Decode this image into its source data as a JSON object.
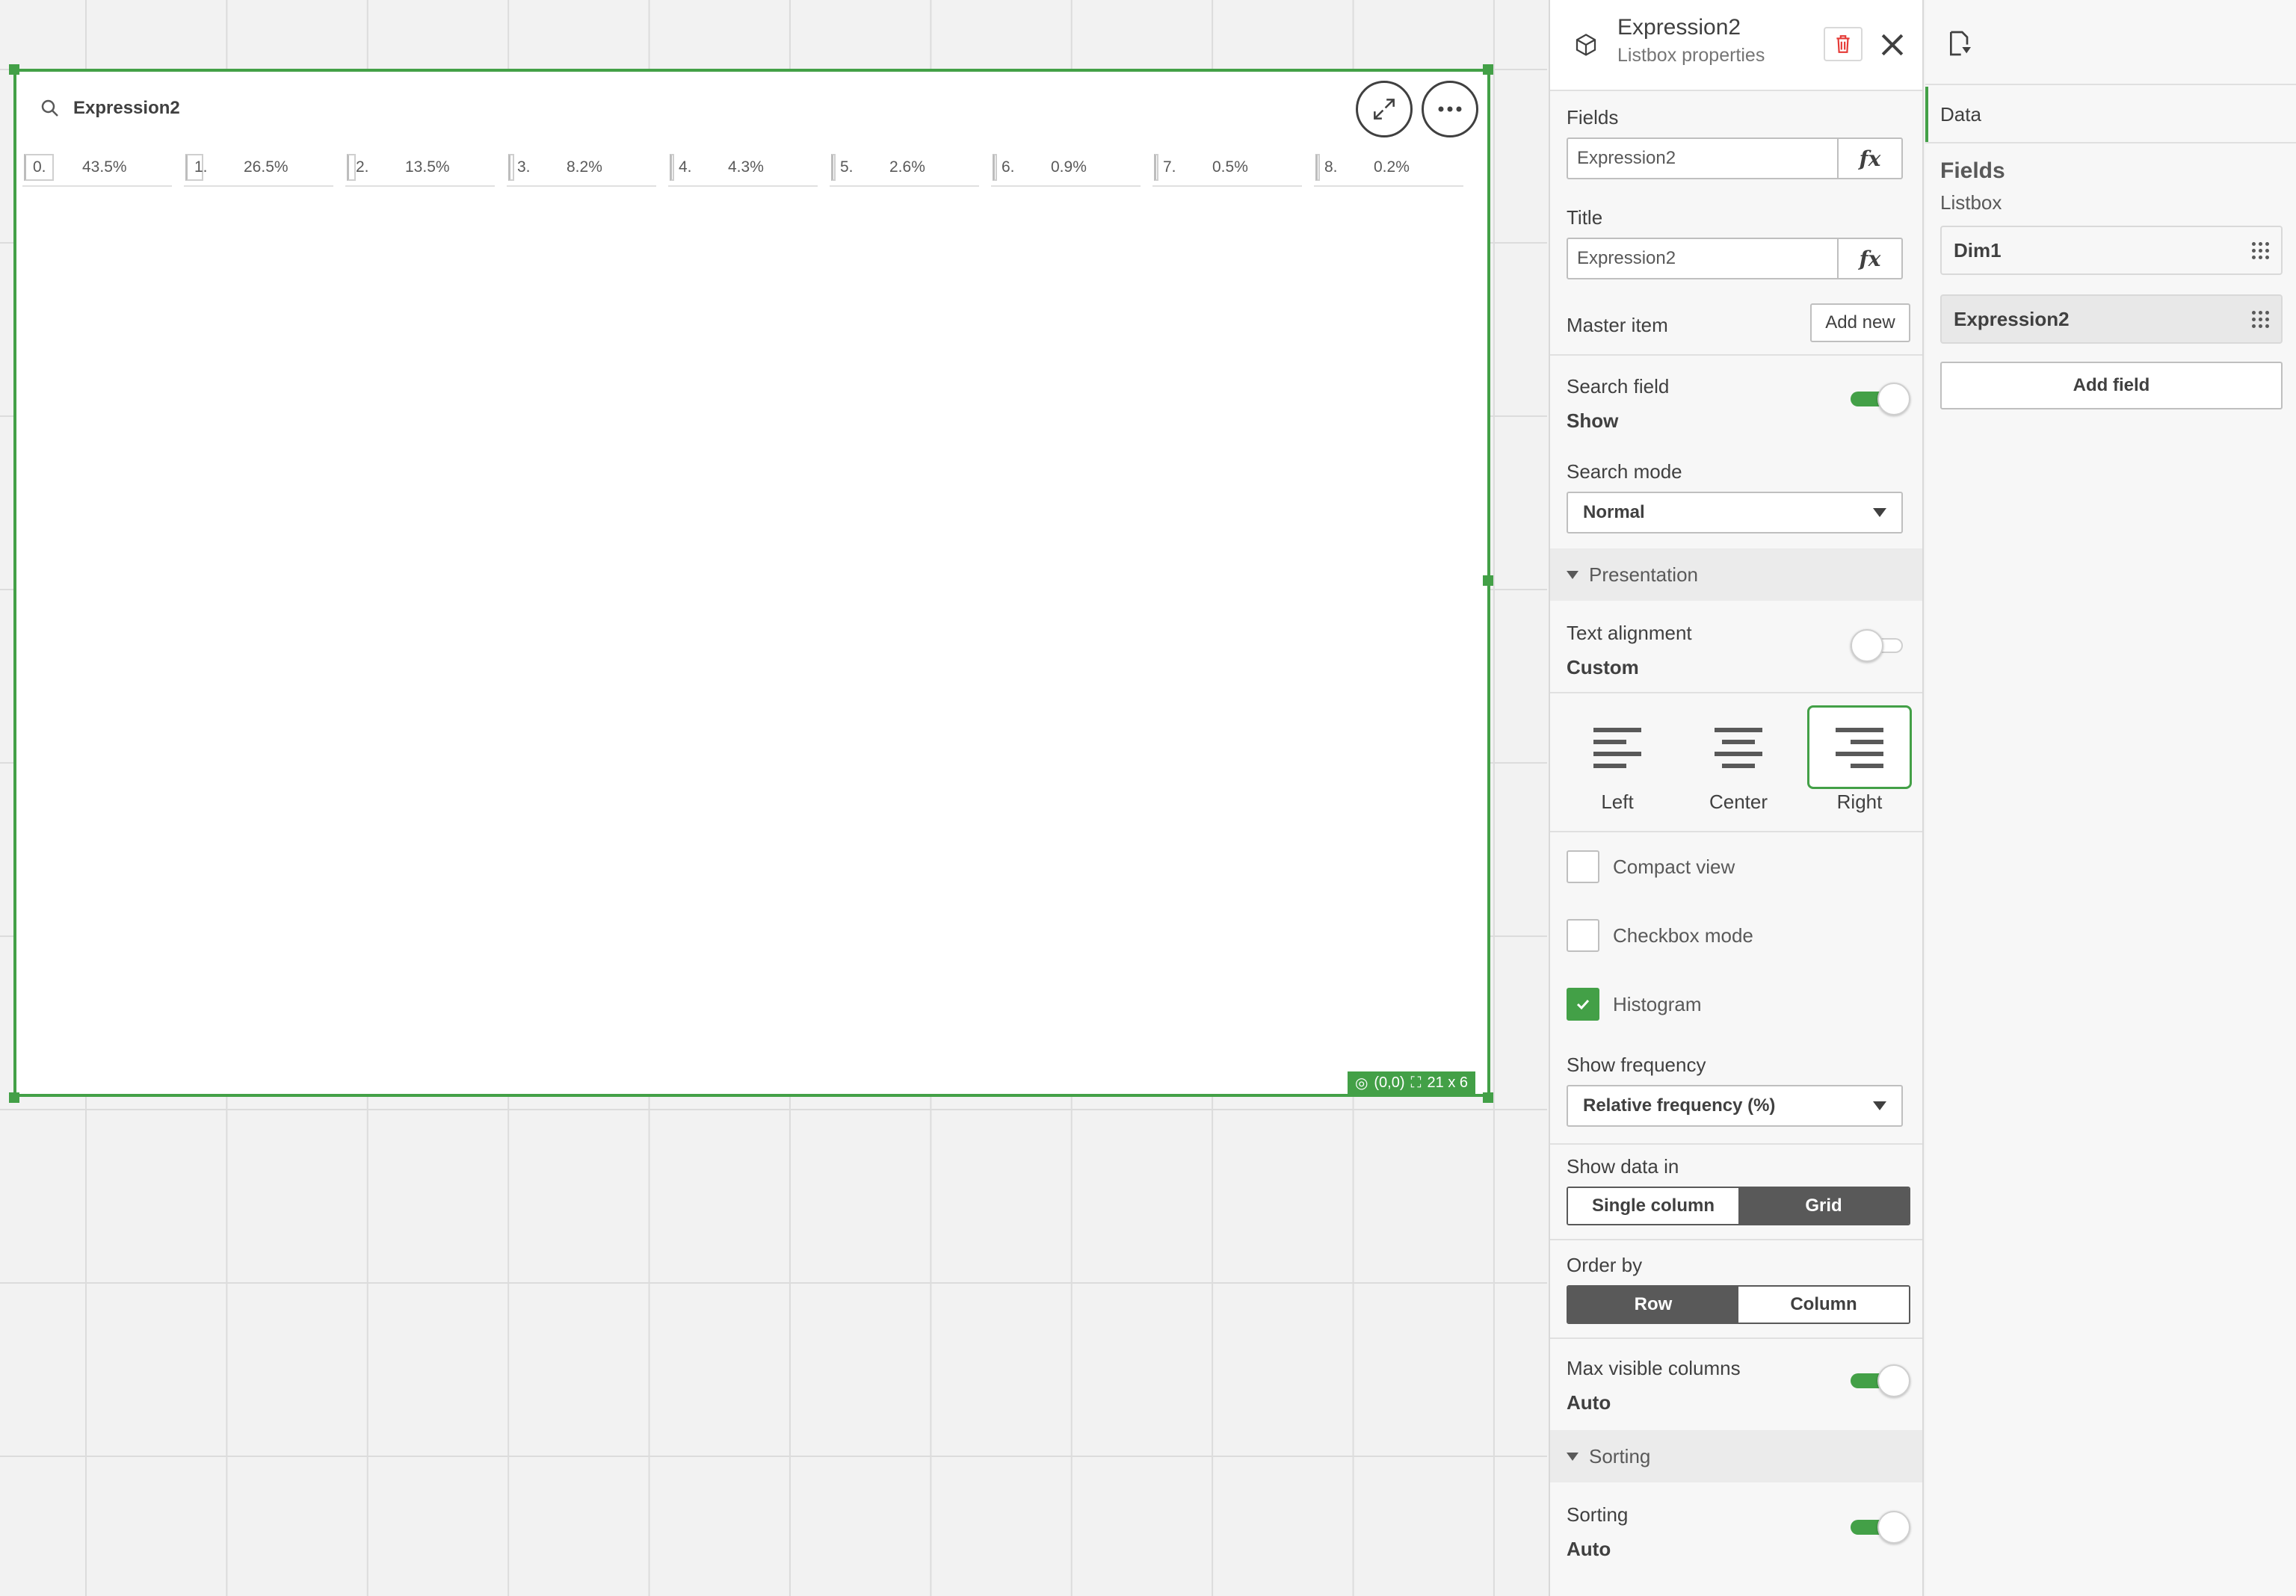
{
  "listbox": {
    "title": "Expression2",
    "cells": [
      {
        "name": "0.",
        "freq": "43.5%",
        "pct": 43.5
      },
      {
        "name": "1.",
        "freq": "26.5%",
        "pct": 26.5
      },
      {
        "name": "2.",
        "freq": "13.5%",
        "pct": 13.5
      },
      {
        "name": "3.",
        "freq": "8.2%",
        "pct": 8.2
      },
      {
        "name": "4.",
        "freq": "4.3%",
        "pct": 4.3
      },
      {
        "name": "5.",
        "freq": "2.6%",
        "pct": 2.6
      },
      {
        "name": "6.",
        "freq": "0.9%",
        "pct": 0.9
      },
      {
        "name": "7.",
        "freq": "0.5%",
        "pct": 0.5
      },
      {
        "name": "8.",
        "freq": "0.2%",
        "pct": 0.2
      }
    ],
    "position": "(0,0)",
    "size": "21 x 6"
  },
  "properties": {
    "title": "Expression2",
    "subtitle": "Listbox properties",
    "fields_label": "Fields",
    "fields_value": "Expression2",
    "title_label": "Title",
    "title_value": "Expression2",
    "fx": "fx",
    "master_item_label": "Master item",
    "add_new": "Add new",
    "search_field_label": "Search field",
    "search_field_value": "Show",
    "search_mode_label": "Search mode",
    "search_mode_value": "Normal",
    "presentation": "Presentation",
    "text_alignment_label": "Text alignment",
    "text_alignment_value": "Custom",
    "align_left": "Left",
    "align_center": "Center",
    "align_right": "Right",
    "compact_view": "Compact view",
    "checkbox_mode": "Checkbox mode",
    "histogram": "Histogram",
    "show_frequency_label": "Show frequency",
    "show_frequency_value": "Relative frequency (%)",
    "show_data_in_label": "Show data in",
    "single_column": "Single column",
    "grid": "Grid",
    "order_by_label": "Order by",
    "row": "Row",
    "column": "Column",
    "max_visible_columns_label": "Max visible columns",
    "max_visible_columns_value": "Auto",
    "sorting_group": "Sorting",
    "sorting_label": "Sorting",
    "sorting_value": "Auto"
  },
  "data_panel": {
    "tab": "Data",
    "heading": "Fields",
    "subheading": "Listbox",
    "fields": [
      "Dim1",
      "Expression2"
    ],
    "add_field": "Add field"
  },
  "colors": {
    "accent": "#43a047",
    "danger": "#e53935",
    "dark": "#595959"
  }
}
